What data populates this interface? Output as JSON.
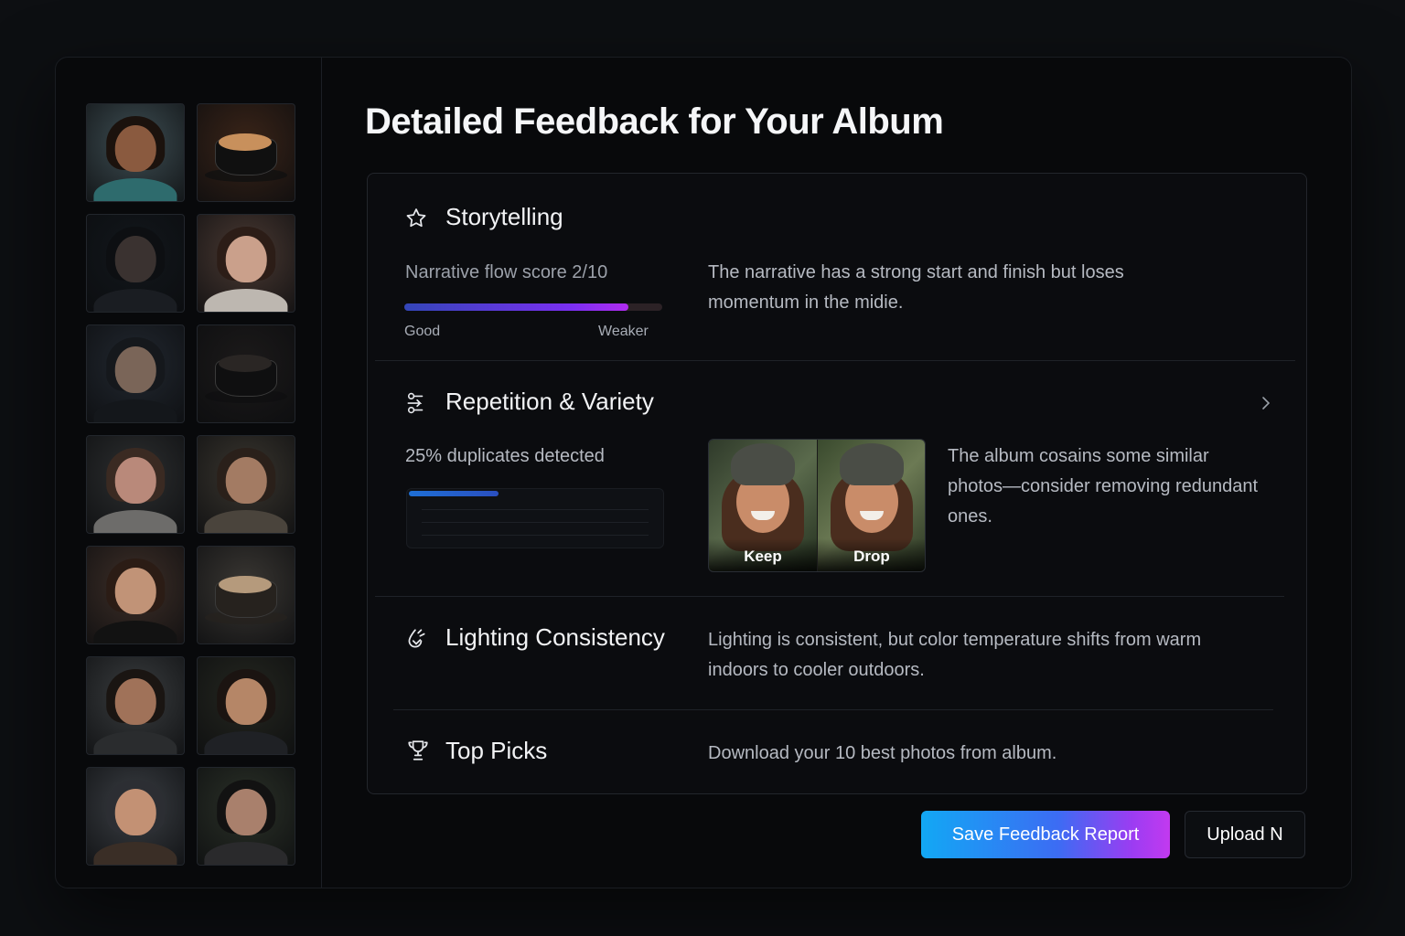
{
  "page": {
    "title": "Detailed Feedback for Your Album"
  },
  "sidebar": {
    "thumbnails": [
      {
        "name": "portrait-curly-hair-woman",
        "kind": "person",
        "bg": "#3e4e53",
        "skin": "#8a5a3f",
        "hair": "#1b120d",
        "shirt": "#2e6b6d"
      },
      {
        "name": "latte-cup",
        "kind": "cup",
        "bg": "#3a2418",
        "cup": "#101010",
        "crema": "#c8905c"
      },
      {
        "name": "reading-dark",
        "kind": "person",
        "bg": "#12171c",
        "skin": "#3a3230",
        "hair": "#0d0f12",
        "shirt": "#1a1d22"
      },
      {
        "name": "woman-at-table",
        "kind": "person",
        "bg": "#4b3a33",
        "skin": "#caa08b",
        "hair": "#2c1d17",
        "shirt": "#bdb7b0"
      },
      {
        "name": "man-dark-jacket",
        "kind": "person",
        "bg": "#222830",
        "skin": "#7a6558",
        "hair": "#15181c",
        "shirt": "#14171b"
      },
      {
        "name": "dark-cup",
        "kind": "cup",
        "bg": "#1c1a1a",
        "cup": "#0f0f10",
        "crema": "#2a2624"
      },
      {
        "name": "woman-long-hair",
        "kind": "person",
        "bg": "#2d2f30",
        "skin": "#b9897a",
        "hair": "#3a2a22",
        "shirt": "#6d6c6a"
      },
      {
        "name": "man-with-phone",
        "kind": "person",
        "bg": "#3a362f",
        "skin": "#a37b63",
        "hair": "#2a201a",
        "shirt": "#4a443c"
      },
      {
        "name": "woman-black-top",
        "kind": "person",
        "bg": "#3e2f28",
        "skin": "#c19377",
        "hair": "#2b1c15",
        "shirt": "#121212"
      },
      {
        "name": "coffee-cup-saucer",
        "kind": "cup",
        "bg": "#3a3733",
        "cup": "#26221e",
        "crema": "#b59a7c"
      },
      {
        "name": "young-man-street",
        "kind": "person",
        "bg": "#3a3d3f",
        "skin": "#a07259",
        "hair": "#1a1512",
        "shirt": "#2a2c2e"
      },
      {
        "name": "young-man-dark-bg",
        "kind": "person",
        "bg": "#252720",
        "skin": "#b58667",
        "hair": "#1b1411",
        "shirt": "#1f2125"
      },
      {
        "name": "woman-beanie",
        "kind": "person",
        "bg": "#3b3f44",
        "skin": "#c39174",
        "hair": "#2c2e33",
        "shirt": "#3a2e26"
      },
      {
        "name": "woman-short-hair",
        "kind": "person",
        "bg": "#2b3128",
        "skin": "#a9806c",
        "hair": "#121212",
        "shirt": "#2a2a2c"
      }
    ]
  },
  "storytelling": {
    "title": "Storytelling",
    "icon": "star-icon",
    "score_label": "Narrative flow score 2/10",
    "score_value": 0.87,
    "scale_left": "Good",
    "scale_right": "Weaker",
    "text": "The narrative has a strong start and finish but loses momentum in the midie."
  },
  "repetition": {
    "title": "Repetition & Variety",
    "icon": "shuffle-icon",
    "duplicates_label": "25% duplicates detected",
    "duplicates_value": 0.35,
    "keep_label": "Keep",
    "drop_label": "Drop",
    "text": "The album cosains some similar photos—consider removing redundant ones."
  },
  "lighting": {
    "title": "Lighting Consistency",
    "icon": "droplet-icon",
    "text": "Lighting is consistent, but color temperature shifts from warm indoors to cooler outdoors."
  },
  "top_picks": {
    "title": "Top Picks",
    "icon": "trophy-icon",
    "text": "Download your 10 best photos from album."
  },
  "actions": {
    "save_label": "Save Feedback Report",
    "upload_label": "Upload N"
  }
}
